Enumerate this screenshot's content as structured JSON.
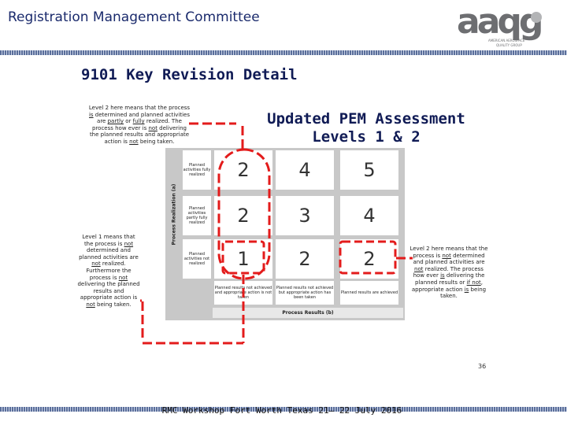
{
  "header": {
    "title": "Registration Management Committee"
  },
  "logo": {
    "letters": "aaqg",
    "line1": "AMERICAN AEROSPACE",
    "line2": "QUALITY GROUP",
    "color_dark": "#6d6e71",
    "color_light": "#b3b4b6"
  },
  "slide": {
    "title": "9101 Key Revision Detail",
    "pem_heading_line1": "Updated PEM Assessment",
    "pem_heading_line2": "Levels  1 & 2"
  },
  "notes": {
    "top_left": {
      "s1": "Level 2 here means that the process ",
      "u1": "is",
      "s2": " determined and planned activities are ",
      "u2": "partly",
      "s3": " or ",
      "u3": "fully",
      "s4": " realized. The process how ever is ",
      "u4": "not",
      "s5": " delivering the planned results and appropriate action is ",
      "u5": "not",
      "s6": " being taken."
    },
    "left": {
      "s1": "Level 1 means that the process is ",
      "u1": "not",
      "s2": " determined and planned activities are ",
      "u2": "not",
      "s3": " realized. Furthermore the process is ",
      "u3": "not",
      "s4": " delivering the planned results and appropriate action is ",
      "u4": "not",
      "s5": " being taken."
    },
    "right": {
      "s1": "Level 2 here means that the process is ",
      "u1": "not",
      "s2": " determined and planned activities are ",
      "u2": "not",
      "s3": " realized. The process how ever ",
      "u3": "is",
      "s4": " delivering the planned results or ",
      "u4": "if not",
      "s5": ", appropriate action ",
      "u5": "is",
      "s6": " being taken."
    }
  },
  "matrix": {
    "y_axis_label": "Process Realization (a)",
    "x_axis_label": "Process Results (b)",
    "row_labels": [
      "Planned activities fully realized",
      "Planned activities partly fully realized",
      "Planned activities not realized"
    ],
    "col_labels": [
      "Planned results not achieved and appropriate action is not taken",
      "Planned results not achieved but appropriate action has been taken",
      "Planned results are achieved"
    ],
    "rows": [
      [
        "2",
        "4",
        "5"
      ],
      [
        "2",
        "3",
        "4"
      ],
      [
        "1",
        "2",
        "2"
      ]
    ],
    "highlight_color": "#e31b1b"
  },
  "page_number": "36",
  "footer": "RMC Workshop Fort Worth Texas 21– 22 July 2016"
}
